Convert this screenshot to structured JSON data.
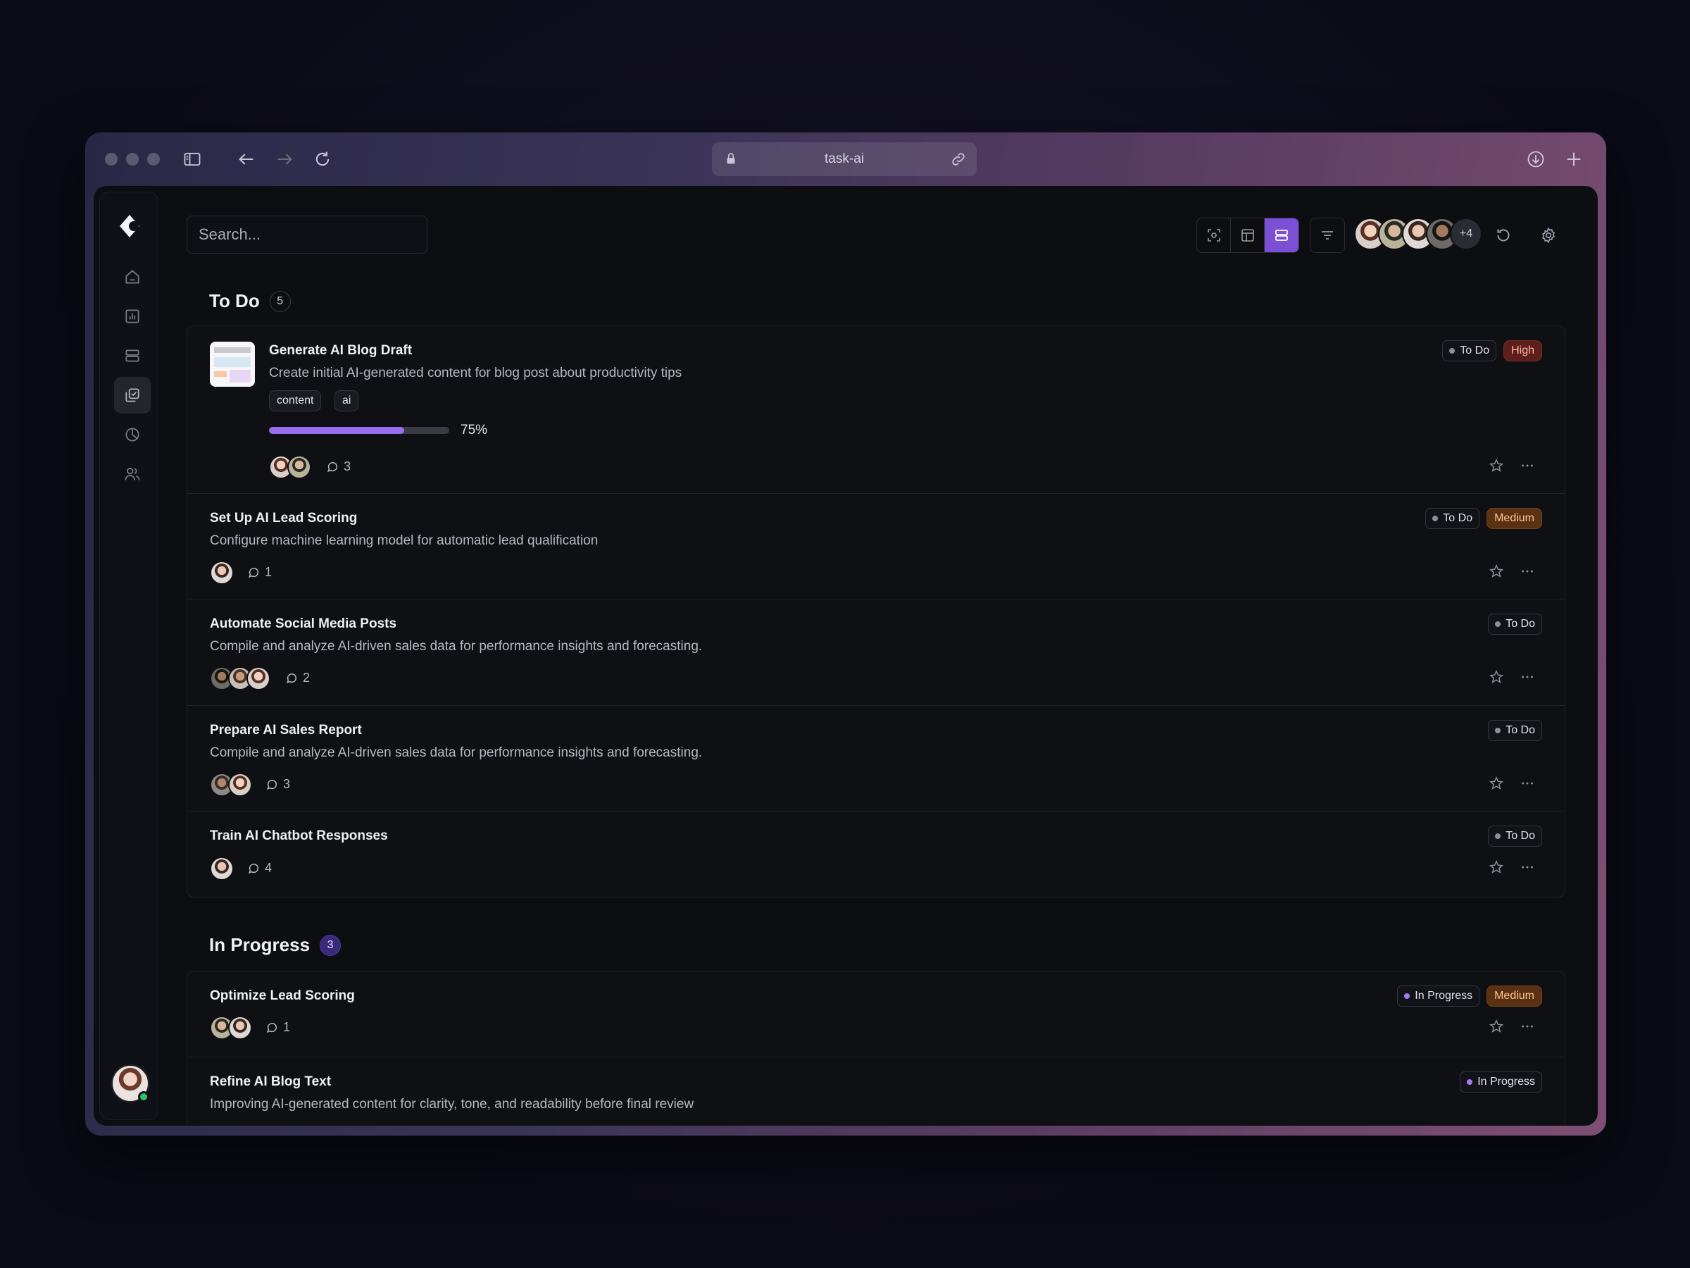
{
  "browser": {
    "url": "task-ai"
  },
  "search": {
    "placeholder": "Search..."
  },
  "team": {
    "extra_count": "+4"
  },
  "sections": {
    "todo": {
      "title": "To Do",
      "count": "5",
      "tasks": [
        {
          "title": "Generate AI Blog Draft",
          "description": "Create initial AI-generated content for blog post about productivity tips",
          "tags": [
            "content",
            "ai"
          ],
          "progress": 0.75,
          "progress_label": "75%",
          "comments": "3",
          "status": "To Do",
          "priority": "High"
        },
        {
          "title": "Set Up AI Lead Scoring",
          "description": "Configure machine learning model for automatic lead qualification",
          "comments": "1",
          "status": "To Do",
          "priority": "Medium"
        },
        {
          "title": "Automate Social Media Posts",
          "description": "Compile and analyze AI-driven sales data for performance insights and forecasting.",
          "comments": "2",
          "status": "To Do"
        },
        {
          "title": "Prepare AI Sales Report",
          "description": "Compile and analyze AI-driven sales data for performance insights and forecasting.",
          "comments": "3",
          "status": "To Do"
        },
        {
          "title": "Train AI Chatbot Responses",
          "comments": "4",
          "status": "To Do"
        }
      ]
    },
    "in_progress": {
      "title": "In Progress",
      "count": "3",
      "tasks": [
        {
          "title": "Optimize Lead Scoring",
          "comments": "1",
          "status": "In Progress",
          "priority": "Medium"
        },
        {
          "title": "Refine AI Blog Text",
          "description": "Improving AI-generated content for clarity, tone, and readability before final review",
          "status": "In Progress"
        }
      ]
    }
  },
  "colors": {
    "accent": "#7b4fd6",
    "progress": "#9a6ef0",
    "high": "#5e1f1c",
    "medium": "#5a3112",
    "online": "#2fc26b"
  }
}
